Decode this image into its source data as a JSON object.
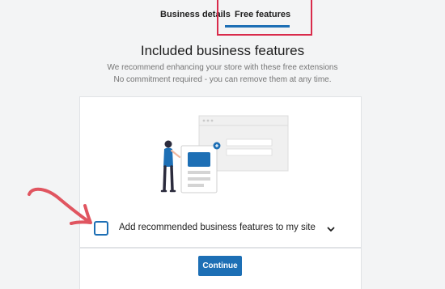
{
  "tabs": [
    {
      "label": "Business details"
    },
    {
      "label": "Free features"
    }
  ],
  "header": {
    "title": "Included business features",
    "subtitle_line1": "We recommend enhancing your store with these free extensions",
    "subtitle_line2": "No commitment required - you can remove them at any time."
  },
  "feature_option": {
    "label": "Add recommended business features to my site",
    "checked": false
  },
  "footer": {
    "continue_label": "Continue"
  },
  "colors": {
    "accent": "#1d6fb5",
    "highlight": "#d92b4b",
    "annotation_arrow": "#e05560",
    "background": "#f3f4f5"
  },
  "icons": {
    "illustration": "store-features-illustration",
    "expand": "chevron-down-icon",
    "annotation": "hand-drawn-arrow-icon"
  }
}
